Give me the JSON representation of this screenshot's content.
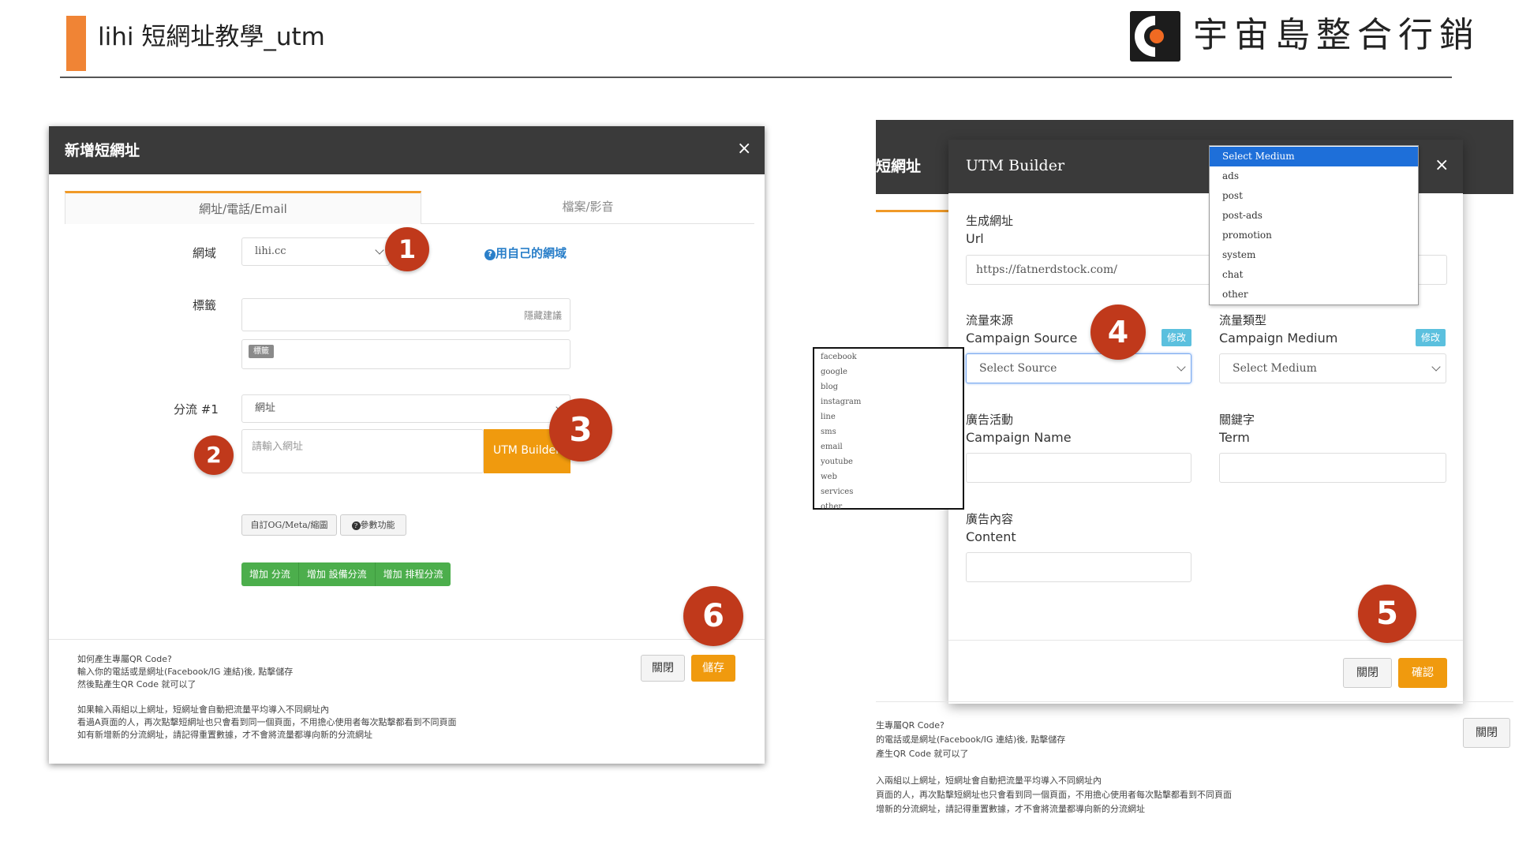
{
  "slide": {
    "title": "lihi 短網址教學_utm",
    "logo_text": "宇宙島整合行銷",
    "accent_color": "#f08435"
  },
  "left_modal": {
    "title": "新增短網址",
    "close": "×",
    "tabs": [
      {
        "label": "網址/電話/Email",
        "active": true
      },
      {
        "label": "檔案/影音",
        "active": false
      }
    ],
    "domain_label": "網域",
    "domain_value": "lihi.cc",
    "own_domain_link": "用自己的網域",
    "tag_label": "標籤",
    "tag_placeholder": "隱藏建議",
    "tag_chip": "標籤",
    "split_label": "分流 #1",
    "split_select": "網址",
    "url_placeholder": "請輸入網址",
    "utm_button": "UTM Builder",
    "og_button": "自訂OG/Meta/縮圖",
    "params_button": "參數功能",
    "green_buttons": [
      "增加 分流",
      "增加 設備分流",
      "增加 排程分流"
    ],
    "notes": [
      "如何產生專屬QR Code?",
      "輸入你的電話或是網址(Facebook/IG 連結)後, 點擊儲存",
      "然後點產生QR Code 就可以了",
      "如果輸入兩組以上網址，短網址會自動把流量平均導入不同網址內",
      "看過A頁面的人，再次點擊短網址也只會看到同一個頁面，不用擔心使用者每次點擊都看到不同頁面",
      "如有新增新的分流網址，請記得重置數據，才不會將流量都導向新的分流網址"
    ],
    "close_button": "關閉",
    "save_button": "儲存"
  },
  "badges": [
    "1",
    "2",
    "3",
    "4",
    "5",
    "6"
  ],
  "right_panel": {
    "bg_title": "短網址",
    "utm_title": "UTM Builder",
    "close": "×",
    "url_label_cn": "生成網址",
    "url_label_en": "Url",
    "url_value": "https://fatnerdstock.com/",
    "source_label_cn": "流量來源",
    "source_label_en": "Campaign Source",
    "source_value": "Select Source",
    "medium_label_cn": "流量類型",
    "medium_label_en": "Campaign Medium",
    "medium_value": "Select Medium",
    "edit_label": "修改",
    "name_label_cn": "廣告活動",
    "name_label_en": "Campaign Name",
    "term_label_cn": "關鍵字",
    "term_label_en": "Term",
    "content_label_cn": "廣告內容",
    "content_label_en": "Content",
    "close_button": "關閉",
    "confirm_button": "確認",
    "outer_close_button": "關閉",
    "medium_options": [
      "Select Medium",
      "ads",
      "post",
      "post-ads",
      "promotion",
      "system",
      "chat",
      "other"
    ],
    "source_options": [
      "facebook",
      "google",
      "blog",
      "instagram",
      "line",
      "sms",
      "email",
      "youtube",
      "web",
      "services",
      "other"
    ],
    "notes": [
      "生專屬QR Code?",
      "的電話或是網址(Facebook/IG 連結)後, 點擊儲存",
      "產生QR Code 就可以了",
      "入兩組以上網址，短網址會自動把流量平均導入不同網址內",
      "頁面的人，再次點擊短網址也只會看到同一個頁面，不用擔心使用者每次點擊都看到不同頁面",
      "增新的分流網址，請記得重置數據，才不會將流量都導向新的分流網址"
    ]
  }
}
